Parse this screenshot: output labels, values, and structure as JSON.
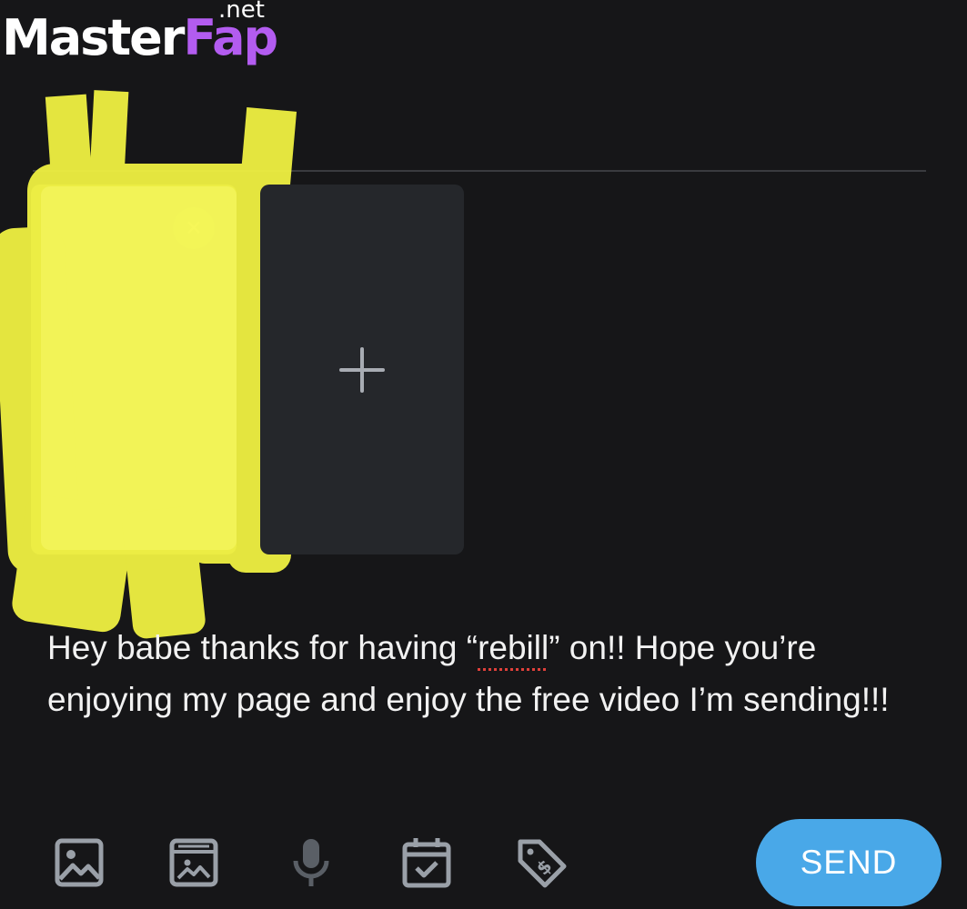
{
  "watermark": {
    "main_white": "Master",
    "main_accent": "Fap",
    "tld": ".net"
  },
  "composer": {
    "message_part1": "Hey babe thanks for having “",
    "message_spell": "rebill",
    "message_part2": "” on!! Hope you’re enjoying my page and enjoy the free video I’m sending!!!",
    "attachments": [
      {
        "kind": "redacted-media-thumbnail"
      },
      {
        "kind": "add-media-tile"
      }
    ]
  },
  "toolbar": {
    "icons": [
      "image-icon",
      "media-vault-icon",
      "microphone-icon",
      "calendar-check-icon",
      "price-tag-icon"
    ],
    "send_label": "SEND"
  },
  "colors": {
    "background": "#161618",
    "redaction_yellow": "#f4f542",
    "send_button": "#49a8e8",
    "tool_icon": "#9aa0a8"
  }
}
